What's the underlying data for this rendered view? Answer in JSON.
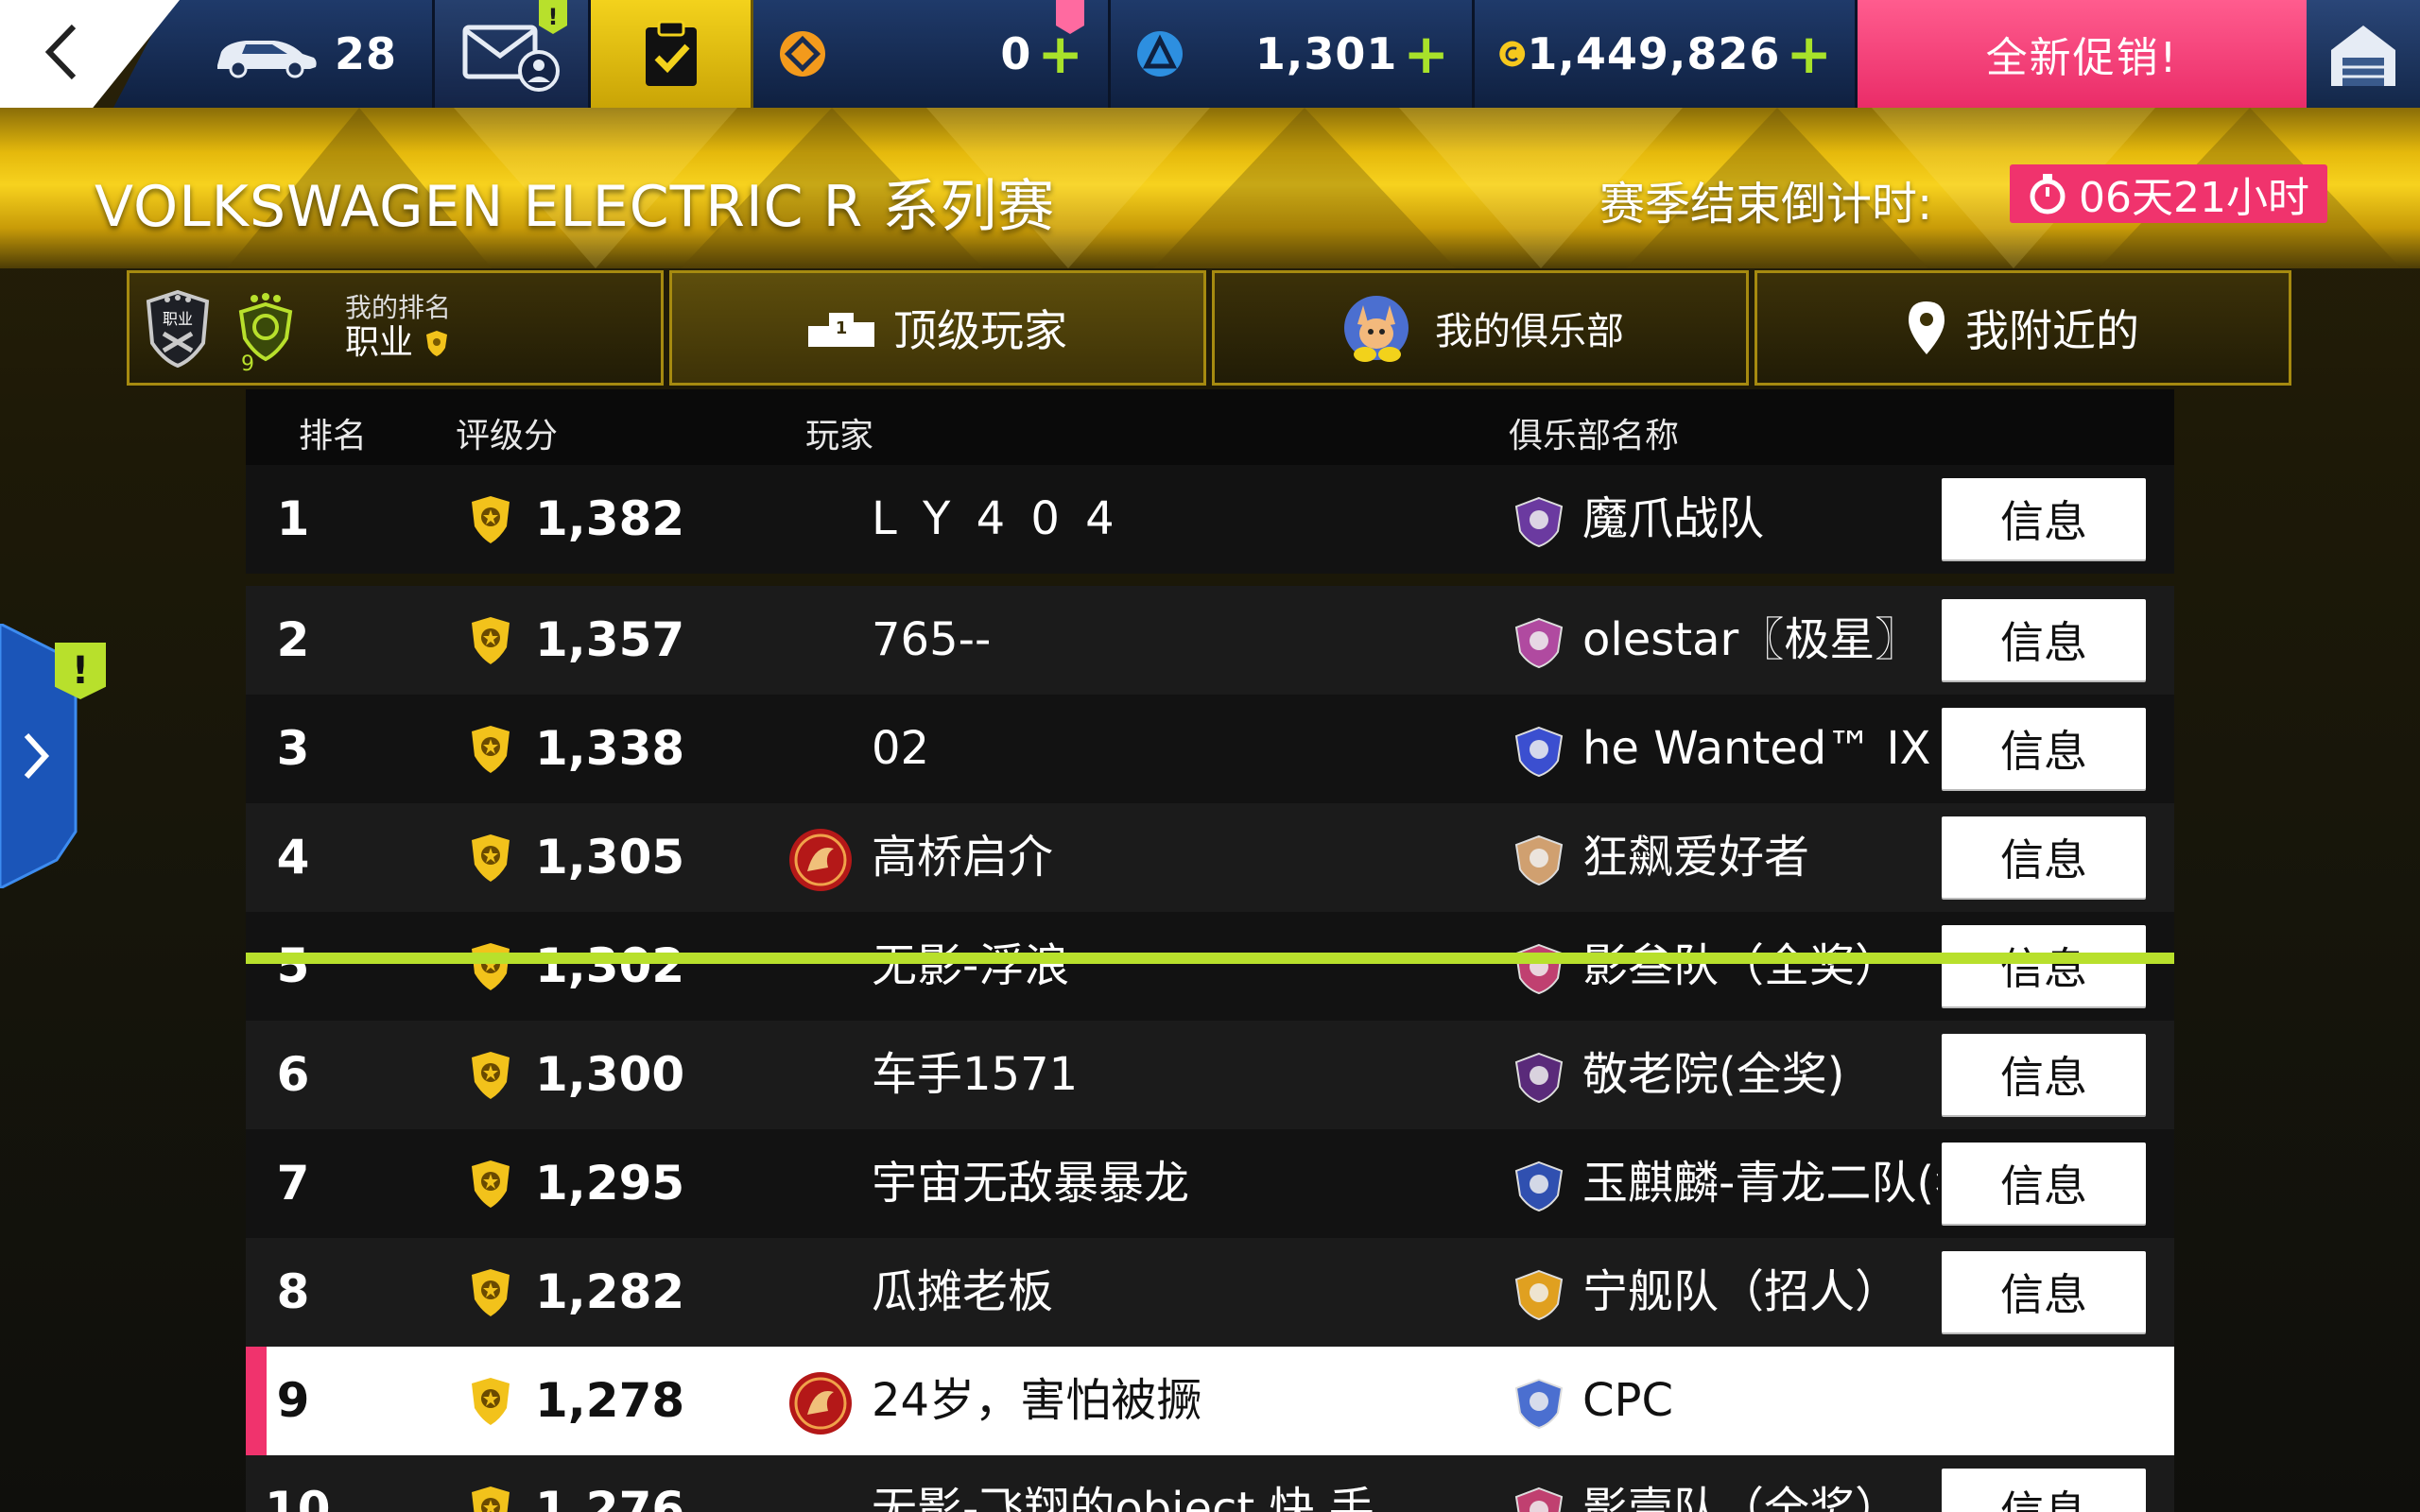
{
  "topbar": {
    "cars_count": "28",
    "tokens": "0",
    "blueprints": "1,301",
    "credits": "1,449,826",
    "promo_label": "全新促销!",
    "mail_alert": "!"
  },
  "banner": {
    "title": "VOLKSWAGEN ELECTRIC R 系列赛",
    "season_label": "赛季结束倒计时:",
    "season_timer": "06天21小时"
  },
  "tabs": {
    "my_rank_label": "我的排名",
    "my_rank_value": "职业",
    "league_badge": "职业",
    "level": "9",
    "top_players": "顶级玩家",
    "podium_number": "1",
    "my_club": "我的俱乐部",
    "near_me": "我附近的"
  },
  "table": {
    "headers": {
      "rank": "排名",
      "score": "评级分",
      "player": "玩家",
      "club": "俱乐部名称"
    },
    "info_label": "信息",
    "rows": [
      {
        "rank": "1",
        "score": "1,382",
        "player": "L Y 4 0 4",
        "club": "魔爪战队",
        "avatar": false
      },
      {
        "rank": "2",
        "score": "1,357",
        "player": "765--",
        "club": "olestar〖极星〗",
        "avatar": false
      },
      {
        "rank": "3",
        "score": "1,338",
        "player": "02",
        "club": "he Wanted™ IX",
        "avatar": false
      },
      {
        "rank": "4",
        "score": "1,305",
        "player": "高桥启介",
        "club": "狂飙爱好者",
        "avatar": true
      },
      {
        "rank": "5",
        "score": "1,302",
        "player": "无影-浮浪",
        "club": "影叁队（全奖）",
        "avatar": false
      },
      {
        "rank": "6",
        "score": "1,300",
        "player": "车手1571",
        "club": "敬老院(全奖)",
        "avatar": false
      },
      {
        "rank": "7",
        "score": "1,295",
        "player": "宇宙无敌暴暴龙",
        "club": "玉麒麟-青龙二队(狂",
        "avatar": false
      },
      {
        "rank": "8",
        "score": "1,282",
        "player": "瓜摊老板",
        "club": "宁舰队（招人）",
        "avatar": false
      },
      {
        "rank": "9",
        "score": "1,278",
        "player": "24岁，害怕被撅",
        "club": "CPC",
        "avatar": true,
        "me": true
      },
      {
        "rank": "10",
        "score": "1,276",
        "player": "无影-飞翔的object 快 手",
        "club": "影壹队（全奖）",
        "avatar": false
      }
    ]
  },
  "side": {
    "alert": "!"
  },
  "colors": {
    "accent_gold": "#f7d21e",
    "accent_green": "#b8e02c",
    "accent_pink": "#f0336d",
    "topbar_blue": "#1f3a6a"
  },
  "icons": {
    "back": "chevron-left-icon",
    "cars": "car-icon",
    "mail": "mail-icon",
    "task": "clipboard-check-icon",
    "token": "token-icon",
    "blueprint": "blueprint-icon",
    "credits": "credits-icon",
    "home": "garage-home-icon",
    "timer": "stopwatch-icon",
    "podium": "podium-icon",
    "club": "club-emblem-icon",
    "location": "location-pin-icon",
    "expand": "chevron-right-icon"
  }
}
